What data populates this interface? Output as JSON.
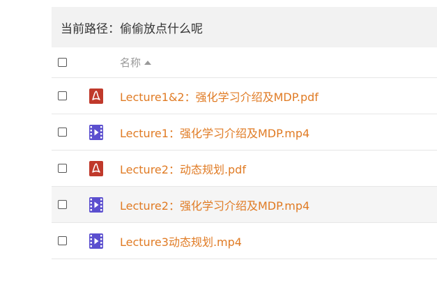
{
  "path_bar": {
    "label": "当前路径：",
    "folder": "偷偷放点什么呢"
  },
  "table": {
    "column_name": "名称",
    "sort_icon": "sort-ascending-icon",
    "files": [
      {
        "name": "Lecture1&2：强化学习介绍及MDP.pdf",
        "type": "pdf",
        "icon": "pdf-file-icon"
      },
      {
        "name": "Lecture1：强化学习介绍及MDP.mp4",
        "type": "video",
        "icon": "video-file-icon"
      },
      {
        "name": "Lecture2：动态规划.pdf",
        "type": "pdf",
        "icon": "pdf-file-icon"
      },
      {
        "name": "Lecture2：强化学习介绍及MDP.mp4",
        "type": "video",
        "icon": "video-file-icon"
      },
      {
        "name": "Lecture3动态规划.mp4",
        "type": "video",
        "icon": "video-file-icon"
      }
    ]
  },
  "colors": {
    "link": "#e07b24",
    "pdf_icon": "#c0392b",
    "video_icon": "#5b4fcf",
    "path_bar_bg": "#f2f2f2",
    "hover_row_bg": "#f5f5f5"
  }
}
